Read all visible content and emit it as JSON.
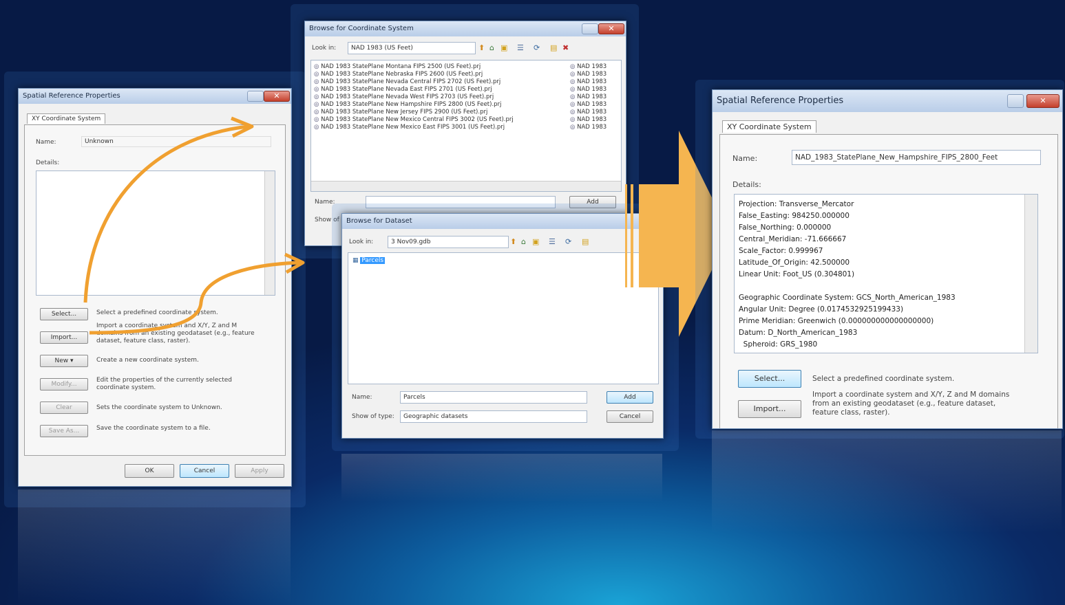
{
  "left_dialog": {
    "title": "Spatial Reference Properties",
    "tab": "XY Coordinate System",
    "name_label": "Name:",
    "name_value": "Unknown",
    "details_label": "Details:",
    "buttons": [
      {
        "label": "Select...",
        "desc": "Select a predefined coordinate system."
      },
      {
        "label": "Import...",
        "desc": "Import a coordinate system and X/Y, Z and M domains from an existing geodataset (e.g., feature dataset, feature class, raster)."
      },
      {
        "label": "New ▾",
        "desc": "Create a new coordinate system."
      },
      {
        "label": "Modify...",
        "desc": "Edit the properties of the currently selected coordinate system."
      },
      {
        "label": "Clear",
        "desc": "Sets the coordinate system to Unknown."
      },
      {
        "label": "Save As...",
        "desc": "Save the coordinate system to a file."
      }
    ],
    "ok": "OK",
    "cancel": "Cancel",
    "apply": "Apply"
  },
  "browse_cs": {
    "title": "Browse for Coordinate System",
    "look_in_label": "Look in:",
    "look_in_value": "NAD 1983 (US Feet)",
    "files": [
      "NAD 1983 StatePlane Montana FIPS 2500 (US Feet).prj",
      "NAD 1983 StatePlane Nebraska FIPS 2600 (US Feet).prj",
      "NAD 1983 StatePlane Nevada Central FIPS 2702 (US Feet).prj",
      "NAD 1983 StatePlane Nevada East FIPS 2701 (US Feet).prj",
      "NAD 1983 StatePlane Nevada West FIPS 2703 (US Feet).prj",
      "NAD 1983 StatePlane New Hampshire FIPS 2800 (US Feet).prj",
      "NAD 1983 StatePlane New Jersey FIPS 2900 (US Feet).prj",
      "NAD 1983 StatePlane New Mexico Central FIPS 3002 (US Feet).prj",
      "NAD 1983 StatePlane New Mexico East FIPS 3001 (US Feet).prj"
    ],
    "files_col2": [
      "NAD 1983",
      "NAD 1983",
      "NAD 1983",
      "NAD 1983",
      "NAD 1983",
      "NAD 1983",
      "NAD 1983",
      "NAD 1983",
      "NAD 1983"
    ],
    "name_label": "Name:",
    "show_label": "Show of",
    "add": "Add"
  },
  "browse_ds": {
    "title": "Browse for Dataset",
    "look_in_label": "Look in:",
    "look_in_value": "3 Nov09.gdb",
    "selected_item": "Parcels",
    "name_label": "Name:",
    "name_value": "Parcels",
    "show_label": "Show of type:",
    "show_value": "Geographic datasets",
    "add": "Add",
    "cancel": "Cancel"
  },
  "right_dialog": {
    "title": "Spatial Reference Properties",
    "tab": "XY Coordinate System",
    "name_label": "Name:",
    "name_value": "NAD_1983_StatePlane_New_Hampshire_FIPS_2800_Feet",
    "details_label": "Details:",
    "details": [
      "Projection: Transverse_Mercator",
      "False_Easting: 984250.000000",
      "False_Northing: 0.000000",
      "Central_Meridian: -71.666667",
      "Scale_Factor: 0.999967",
      "Latitude_Of_Origin: 42.500000",
      "Linear Unit: Foot_US (0.304801)",
      "",
      "Geographic Coordinate System: GCS_North_American_1983",
      "Angular Unit: Degree (0.0174532925199433)",
      "Prime Meridian: Greenwich (0.000000000000000000)",
      "Datum: D_North_American_1983",
      "  Spheroid: GRS_1980"
    ],
    "select": "Select...",
    "select_desc": "Select a predefined coordinate system.",
    "import": "Import...",
    "import_desc": "Import a coordinate system and X/Y, Z and M domains from an existing geodataset (e.g., feature dataset, feature class, raster)."
  },
  "colors": {
    "arrow": "#f0a030",
    "big_arrow": "#f5b550"
  }
}
